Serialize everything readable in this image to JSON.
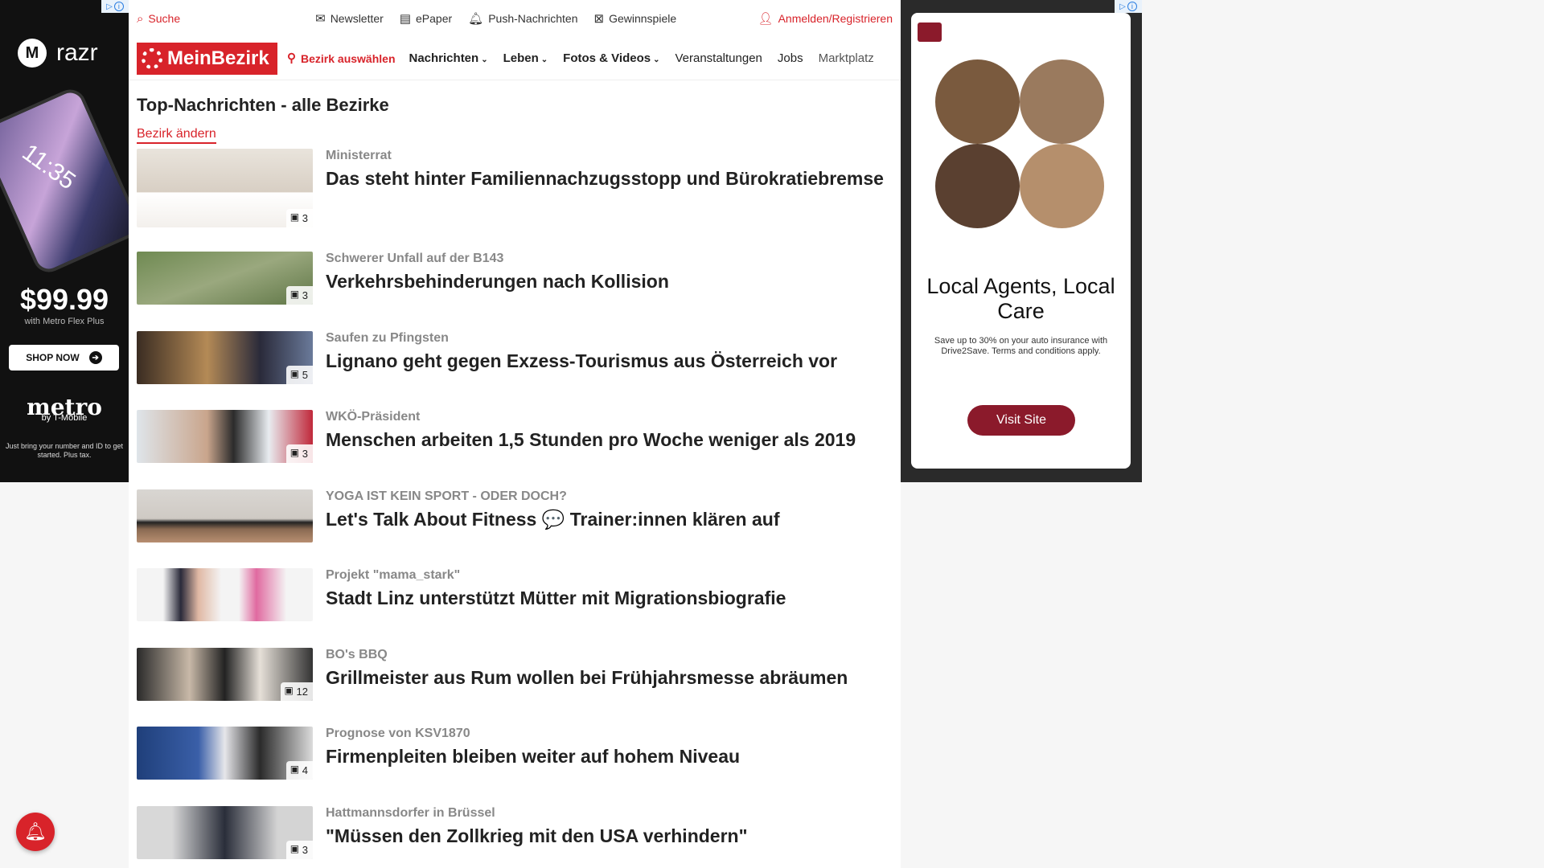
{
  "colors": {
    "accent": "#d8232a",
    "ad_accent": "#8b1a2b"
  },
  "topbar": {
    "search_label": "Suche",
    "newsletter_label": "Newsletter",
    "epaper_label": "ePaper",
    "push_label": "Push-Nachrichten",
    "games_label": "Gewinnspiele",
    "login_label": "Anmelden/Registrieren"
  },
  "nav": {
    "logo_text": "MeinBezirk",
    "bezirk_label": "Bezirk auswählen",
    "items": [
      {
        "label": "Nachrichten"
      },
      {
        "label": "Leben"
      },
      {
        "label": "Fotos & Videos"
      },
      {
        "label": "Veranstaltungen"
      },
      {
        "label": "Jobs"
      },
      {
        "label": "Marktplatz"
      }
    ]
  },
  "page": {
    "title": "Top-Nachrichten - alle Bezirke",
    "change_link": "Bezirk ändern"
  },
  "articles": [
    {
      "kicker": "Ministerrat",
      "headline": "Das steht hinter Familiennachzugsstopp und Bürokratiebremse",
      "image_count": "3"
    },
    {
      "kicker": "Schwerer Unfall auf der B143",
      "headline": "Verkehrsbehinderungen nach Kollision",
      "image_count": "3"
    },
    {
      "kicker": "Saufen zu Pfingsten",
      "headline": "Lignano geht gegen Exzess-Tourismus aus Österreich vor",
      "image_count": "5"
    },
    {
      "kicker": "WKÖ-Präsident",
      "headline": "Menschen arbeiten 1,5 Stunden pro Woche weniger als 2019",
      "image_count": "3"
    },
    {
      "kicker": "YOGA IST KEIN SPORT - ODER DOCH?",
      "headline": "Let's Talk About Fitness 💬 Trainer:innen klären auf",
      "image_count": ""
    },
    {
      "kicker": "Projekt \"mama_stark\"",
      "headline": "Stadt Linz unterstützt Mütter mit Migrationsbiografie",
      "image_count": ""
    },
    {
      "kicker": "BO's BBQ",
      "headline": "Grillmeister aus Rum wollen bei Frühjahrsmesse abräumen",
      "image_count": "12"
    },
    {
      "kicker": "Prognose von KSV1870",
      "headline": "Firmenpleiten bleiben weiter auf hohem Niveau",
      "image_count": "4"
    },
    {
      "kicker": "Hattmannsdorfer in Brüssel",
      "headline": "\"Müssen den Zollkrieg mit den USA verhindern\"",
      "image_count": "3"
    }
  ],
  "ad_left": {
    "brand": "razr",
    "phone_time": "11:35",
    "price": "$99.99",
    "price_sub": "with Metro Flex Plus",
    "button": "SHOP NOW",
    "metro": "metro",
    "metro_sub": "by T-Mobile",
    "fine_print": "Just bring your number and ID to get started. Plus tax."
  },
  "ad_right": {
    "title": "Local Agents, Local Care",
    "description": "Save up to 30% on your auto insurance with Drive2Save. Terms and conditions apply.",
    "button": "Visit Site"
  }
}
